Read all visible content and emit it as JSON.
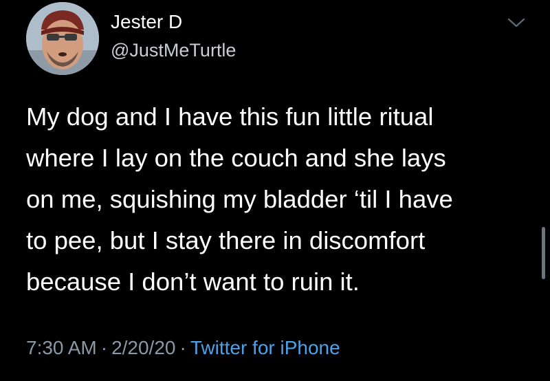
{
  "user": {
    "display_name": "Jester D",
    "handle": "@JustMeTurtle",
    "avatar_icon": "profile-photo"
  },
  "tweet": {
    "lines": [
      "My dog and I have this fun little ritual",
      "where I lay on the couch and she lays",
      "on me, squishing my bladder ‘til I have",
      "to pee, but I stay there in discomfort",
      "because I don’t want to ruin it."
    ]
  },
  "meta": {
    "time": "7:30 AM",
    "separator": "·",
    "date": "2/20/20",
    "source": "Twitter for iPhone"
  },
  "menu": {
    "icon": "chevron-down-icon"
  },
  "colors": {
    "background": "#000000",
    "text": "#ffffff",
    "secondary_text": "#8b98a5",
    "link": "#4aa3ea"
  }
}
